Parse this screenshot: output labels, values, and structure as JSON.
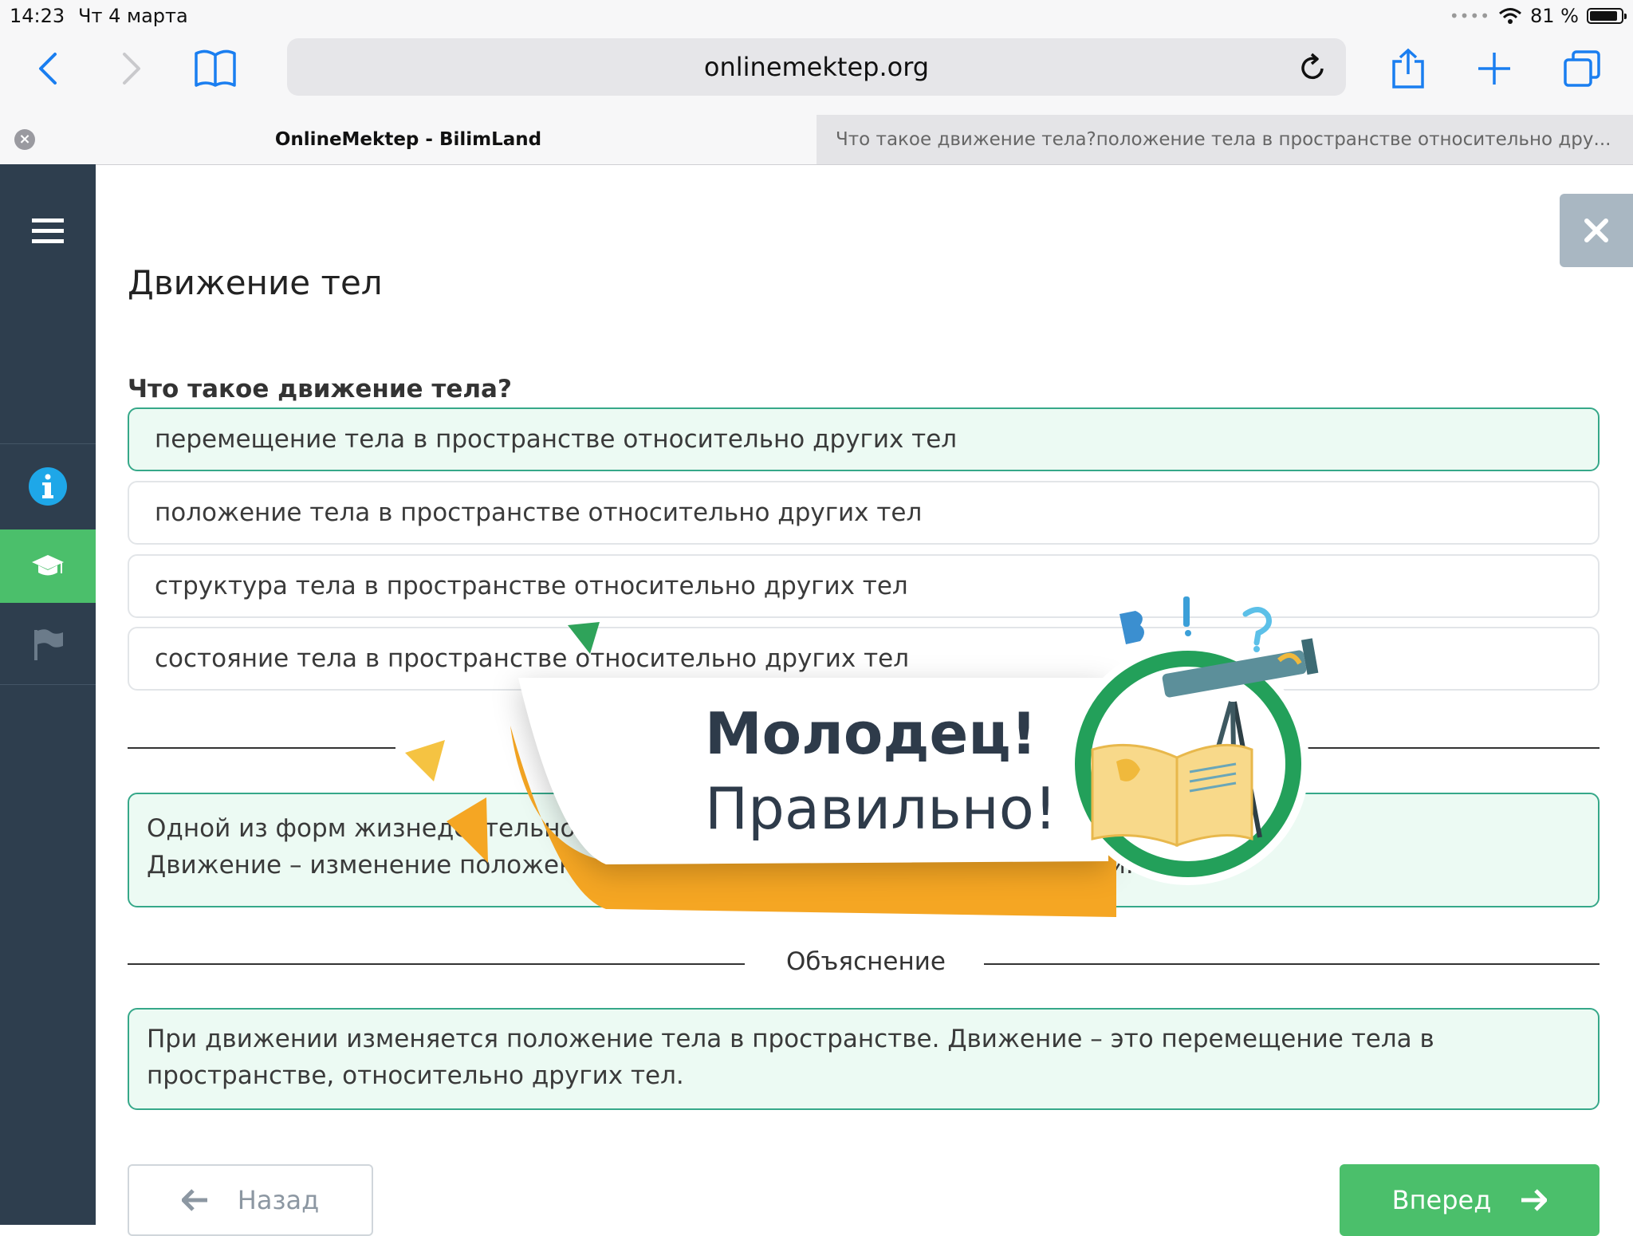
{
  "status": {
    "time": "14:23",
    "date": "Чт 4 марта",
    "battery": "81 %"
  },
  "browser": {
    "url": "onlinemektep.org",
    "tabs": [
      {
        "label": "OnlineMektep - BilimLand"
      },
      {
        "label": "Что такое движение тела?положение тела в пространстве относительно дру..."
      }
    ]
  },
  "page": {
    "title": "Движение тел",
    "question": "Что такое движение тела?",
    "options": [
      {
        "label": "перемещение тела в пространстве относительно других тел",
        "state": "correct"
      },
      {
        "label": "положение тела в пространстве относительно других тел",
        "state": "default"
      },
      {
        "label": "структура тела в пространстве относительно других тел",
        "state": "default"
      },
      {
        "label": "состояние тела в пространстве относительно других тел",
        "state": "default"
      }
    ],
    "info": {
      "line1": "Одной из форм жизнедеятельно",
      "line2": "Движение – изменение положени",
      "line2_end": "времени."
    },
    "explanation_label": "Объяснение",
    "explanation_text": "При движении изменяется положение тела в пространстве. Движение – это перемещение тела в пространстве, относительно других тел.",
    "back_label": "Назад",
    "next_label": "Вперед"
  },
  "popup": {
    "title": "Молодец!",
    "subtitle": "Правильно!"
  },
  "colors": {
    "sidebar": "#2e3e4e",
    "accent_green": "#4bbf6b",
    "correct_border": "#36a889",
    "correct_bg": "#ecfaf3",
    "info_blue": "#1ea7e8",
    "ribbon_orange": "#f5a623"
  }
}
